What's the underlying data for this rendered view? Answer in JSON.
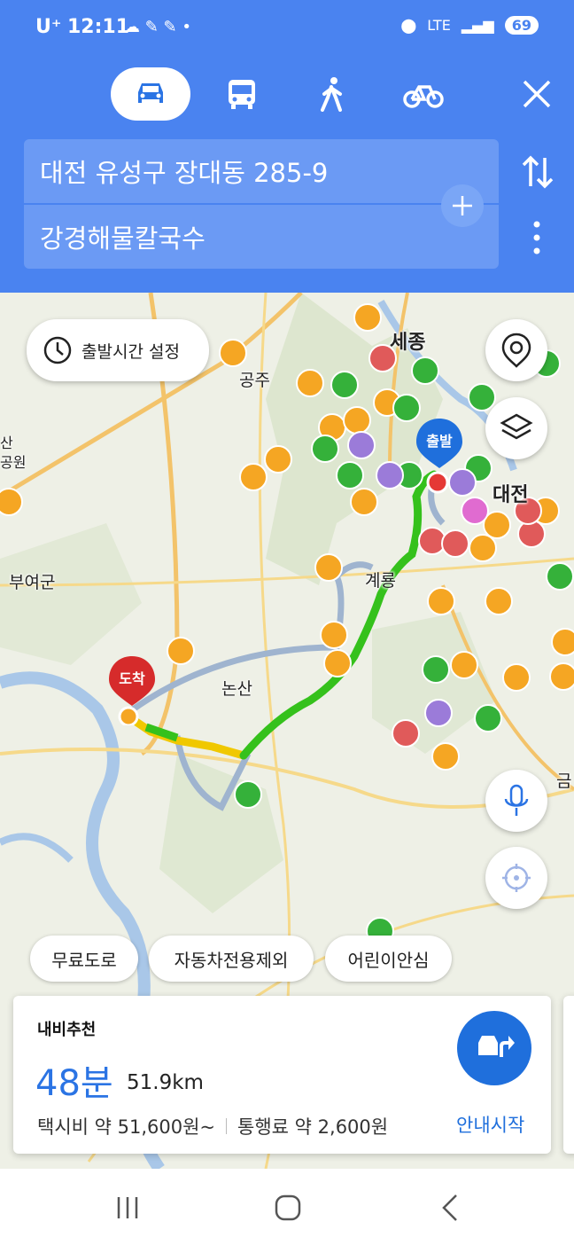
{
  "status_bar": {
    "carrier": "U⁺",
    "time": "12:11",
    "network": "LTE",
    "battery": "69"
  },
  "transport_modes": [
    {
      "name": "car",
      "icon": "car-icon",
      "selected": true
    },
    {
      "name": "bus",
      "icon": "bus-icon"
    },
    {
      "name": "walk",
      "icon": "walk-icon"
    },
    {
      "name": "bike",
      "icon": "bike-icon"
    }
  ],
  "route_inputs": {
    "origin": "대전 유성구 장대동 285-9",
    "destination": "강경해물칼국수"
  },
  "map": {
    "departure_time_label": "출발시간 설정",
    "labels": {
      "sejong": "세종",
      "gongju": "공주",
      "daejeon": "대전",
      "buyeo": "부여군",
      "gyeryong": "계룡",
      "nonsan": "논산",
      "geum": "금",
      "san": "산",
      "park": "공원"
    },
    "start_marker": "출발",
    "end_marker": "도착"
  },
  "filter_chips": [
    "무료도로",
    "자동차전용제외",
    "어린이안심"
  ],
  "route_card": {
    "tag": "내비추천",
    "duration": "48분",
    "distance": "51.9km",
    "taxi_fare": "택시비 약 51,600원~",
    "toll": "통행료 약 2,600원",
    "start_button": "안내시작"
  },
  "colors": {
    "header": "#4a83f0",
    "accent": "#1f6fdc",
    "route_green": "#35c11c",
    "route_yellow": "#f0c800",
    "start_marker": "#1f6fdc",
    "end_marker": "#d62b2b"
  }
}
